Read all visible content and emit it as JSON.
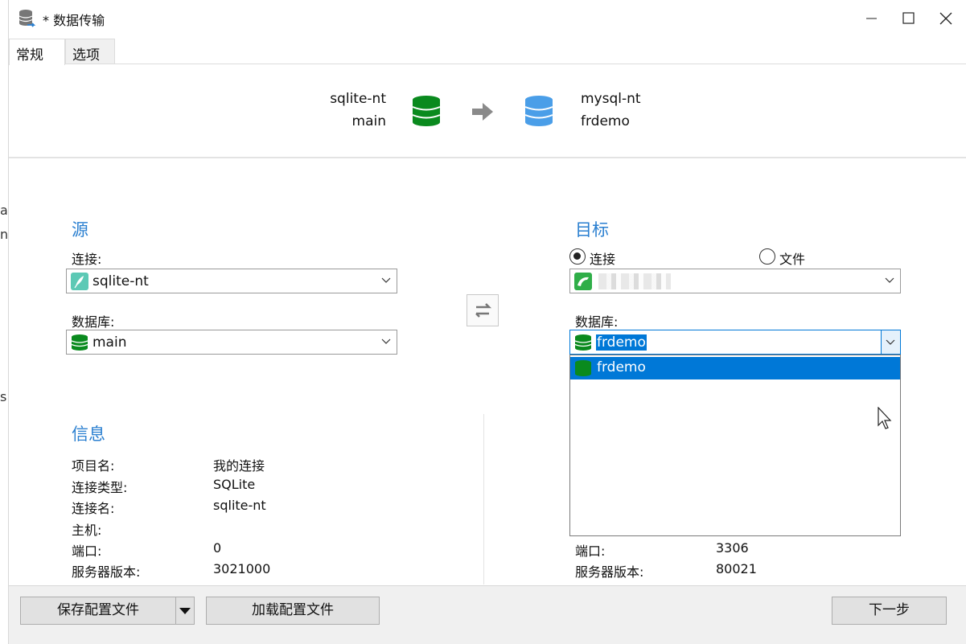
{
  "window": {
    "title": "* 数据传输"
  },
  "tabs": [
    {
      "label": "常规"
    },
    {
      "label": "选项"
    }
  ],
  "flow": {
    "source_name": "sqlite-nt",
    "source_db": "main",
    "target_name": "mysql-nt",
    "target_db": "frdemo"
  },
  "source": {
    "title": "源",
    "connection_label": "连接:",
    "connection_value": "sqlite-nt",
    "database_label": "数据库:",
    "database_value": "main"
  },
  "target": {
    "title": "目标",
    "radio_connection": "连接",
    "radio_file": "文件",
    "database_label": "数据库:",
    "database_value": "frdemo",
    "dropdown_options": [
      "frdemo"
    ]
  },
  "info": {
    "title": "信息",
    "rows": [
      {
        "label": "项目名:",
        "value": "我的连接"
      },
      {
        "label": "连接类型:",
        "value": "SQLite"
      },
      {
        "label": "连接名:",
        "value": "sqlite-nt"
      },
      {
        "label": "主机:",
        "value": ""
      },
      {
        "label": "端口:",
        "value": "0"
      },
      {
        "label": "服务器版本:",
        "value": "3021000"
      }
    ],
    "target_rows": [
      {
        "label": "端口:",
        "value": "3306"
      },
      {
        "label": "服务器版本:",
        "value": "80021"
      }
    ]
  },
  "buttons": {
    "save_profile": "保存配置文件",
    "load_profile": "加载配置文件",
    "next": "下一步"
  },
  "background_text": [
    "a",
    "nf",
    "s"
  ],
  "colors": {
    "accent": "#0078d7",
    "section_title": "#2a7fd0",
    "sqlite_db": "#0a8a1e",
    "mysql_db": "#4a9ee8"
  }
}
